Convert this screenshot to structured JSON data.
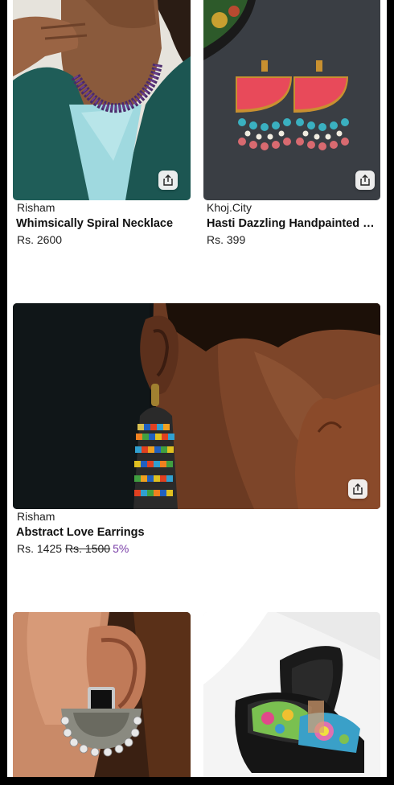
{
  "theme": {
    "discount_color": "#7a3fa8"
  },
  "products": [
    {
      "brand": "Risham",
      "name": "Whimsically Spiral Necklace",
      "price": "Rs. 2600",
      "image": "woman in teal blazer wearing purple beaded spiral necklace",
      "share_icon": "share-icon"
    },
    {
      "brand": "Khoj.City",
      "name": "Hasti Dazzling Handpainted Earrings",
      "price": "Rs. 399",
      "image": "red handpainted half-moon earrings with turquoise beads",
      "share_icon": "share-icon"
    },
    {
      "brand": "Risham",
      "name": "Abstract Love Earrings",
      "price": "Rs. 1425",
      "original_price": "Rs. 1500",
      "discount": "5%",
      "image": "ear with colorful beaded long earring",
      "share_icon": "share-icon"
    },
    {
      "image": "silver half-moon earring with black stone on ear"
    },
    {
      "image": "black platform sandals with colorful embroidery"
    }
  ]
}
